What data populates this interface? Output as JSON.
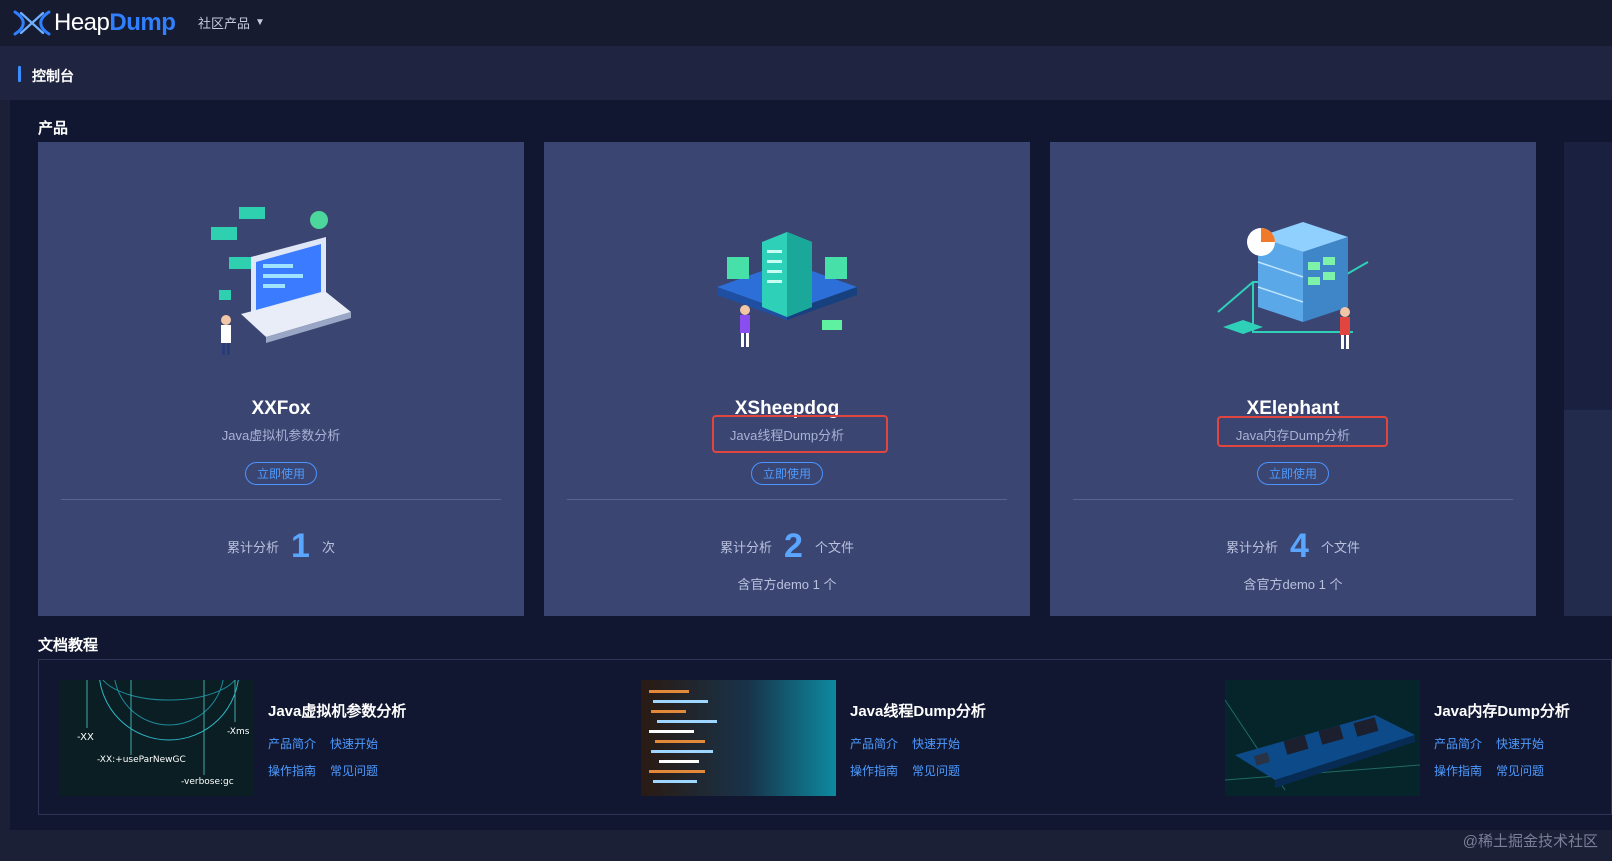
{
  "header": {
    "logo_heap": "Heap",
    "logo_dump": "Dump",
    "nav_menu": "社区产品"
  },
  "breadcrumb": {
    "title": "控制台"
  },
  "products": {
    "section_title": "产品",
    "items": [
      {
        "name": "XXFox",
        "subtitle": "Java虚拟机参数分析",
        "button": "立即使用",
        "stat_prefix": "累计分析",
        "stat_value": "1",
        "stat_unit": "次",
        "note": ""
      },
      {
        "name": "XSheepdog",
        "subtitle": "Java线程Dump分析",
        "button": "立即使用",
        "stat_prefix": "累计分析",
        "stat_value": "2",
        "stat_unit": "个文件",
        "note": "含官方demo 1 个"
      },
      {
        "name": "XElephant",
        "subtitle": "Java内存Dump分析",
        "button": "立即使用",
        "stat_prefix": "累计分析",
        "stat_value": "4",
        "stat_unit": "个文件",
        "note": "含官方demo 1 个"
      }
    ]
  },
  "docs": {
    "section_title": "文档教程",
    "items": [
      {
        "title": "Java虚拟机参数分析",
        "links": [
          "产品简介",
          "快速开始",
          "操作指南",
          "常见问题"
        ],
        "thumb_text": [
          "-XX",
          "-Xms",
          "-XX:+useParNewGC",
          "-verbose:gc"
        ]
      },
      {
        "title": "Java线程Dump分析",
        "links": [
          "产品简介",
          "快速开始",
          "操作指南",
          "常见问题"
        ]
      },
      {
        "title": "Java内存Dump分析",
        "links": [
          "产品简介",
          "快速开始",
          "操作指南",
          "常见问题"
        ]
      }
    ]
  },
  "watermark": "@稀土掘金技术社区",
  "colors": {
    "accent": "#3a8dff",
    "card_bg": "#3a4572",
    "highlight": "#e0453f"
  }
}
